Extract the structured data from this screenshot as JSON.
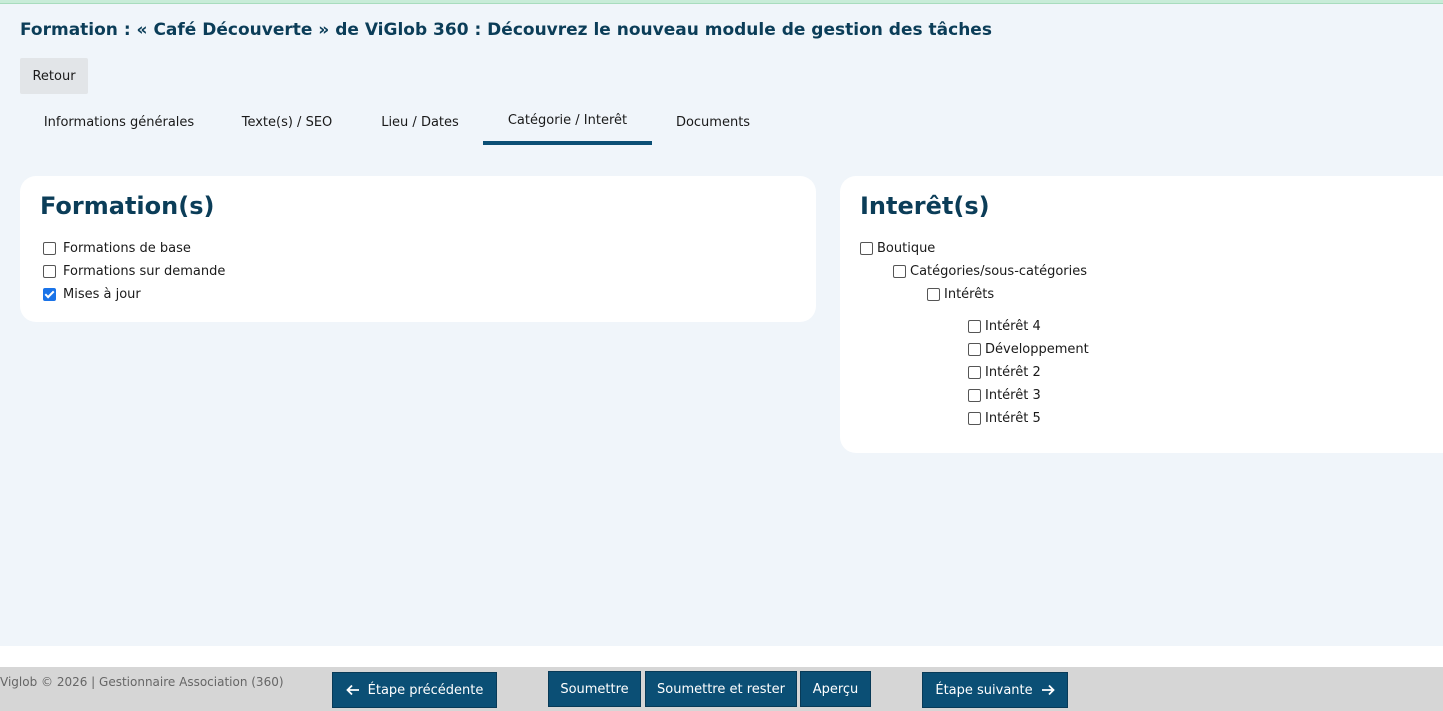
{
  "page_title": "Formation : « Café Découverte » de ViGlob 360 : Découvrez le nouveau module de gestion des tâches",
  "back_label": "Retour",
  "tabs": [
    {
      "label": "Informations générales",
      "active": false
    },
    {
      "label": "Texte(s) / SEO",
      "active": false
    },
    {
      "label": "Lieu / Dates",
      "active": false
    },
    {
      "label": "Catégorie / Interêt",
      "active": true
    },
    {
      "label": "Documents",
      "active": false
    }
  ],
  "formations": {
    "title": "Formation(s)",
    "items": [
      {
        "label": "Formations de base",
        "checked": false
      },
      {
        "label": "Formations sur demande",
        "checked": false
      },
      {
        "label": "Mises à jour",
        "checked": true
      }
    ]
  },
  "interets": {
    "title": "Interêt(s)",
    "items": [
      {
        "label": "Boutique",
        "checked": false
      },
      {
        "label": "Catégories/sous-catégories",
        "checked": false
      },
      {
        "label": "Intérêts",
        "checked": false
      },
      {
        "label": "Intérêt 4",
        "checked": false
      },
      {
        "label": "Développement",
        "checked": false
      },
      {
        "label": "Intérêt 2",
        "checked": false
      },
      {
        "label": "Intérêt 3",
        "checked": false
      },
      {
        "label": "Intérêt 5",
        "checked": false
      }
    ]
  },
  "footer": {
    "copyright": "Viglob © 2026 | Gestionnaire Association (360)",
    "prev_label": "Étape précédente",
    "submit_label": "Soumettre",
    "submit_stay_label": "Soumettre et rester",
    "preview_label": "Aperçu",
    "next_label": "Étape suivante"
  },
  "colors": {
    "accent": "#0b4f75",
    "title": "#0b3d58",
    "background": "#f0f5fa",
    "footer": "#d6d6d6",
    "checkbox_checked": "#1a73e8"
  }
}
